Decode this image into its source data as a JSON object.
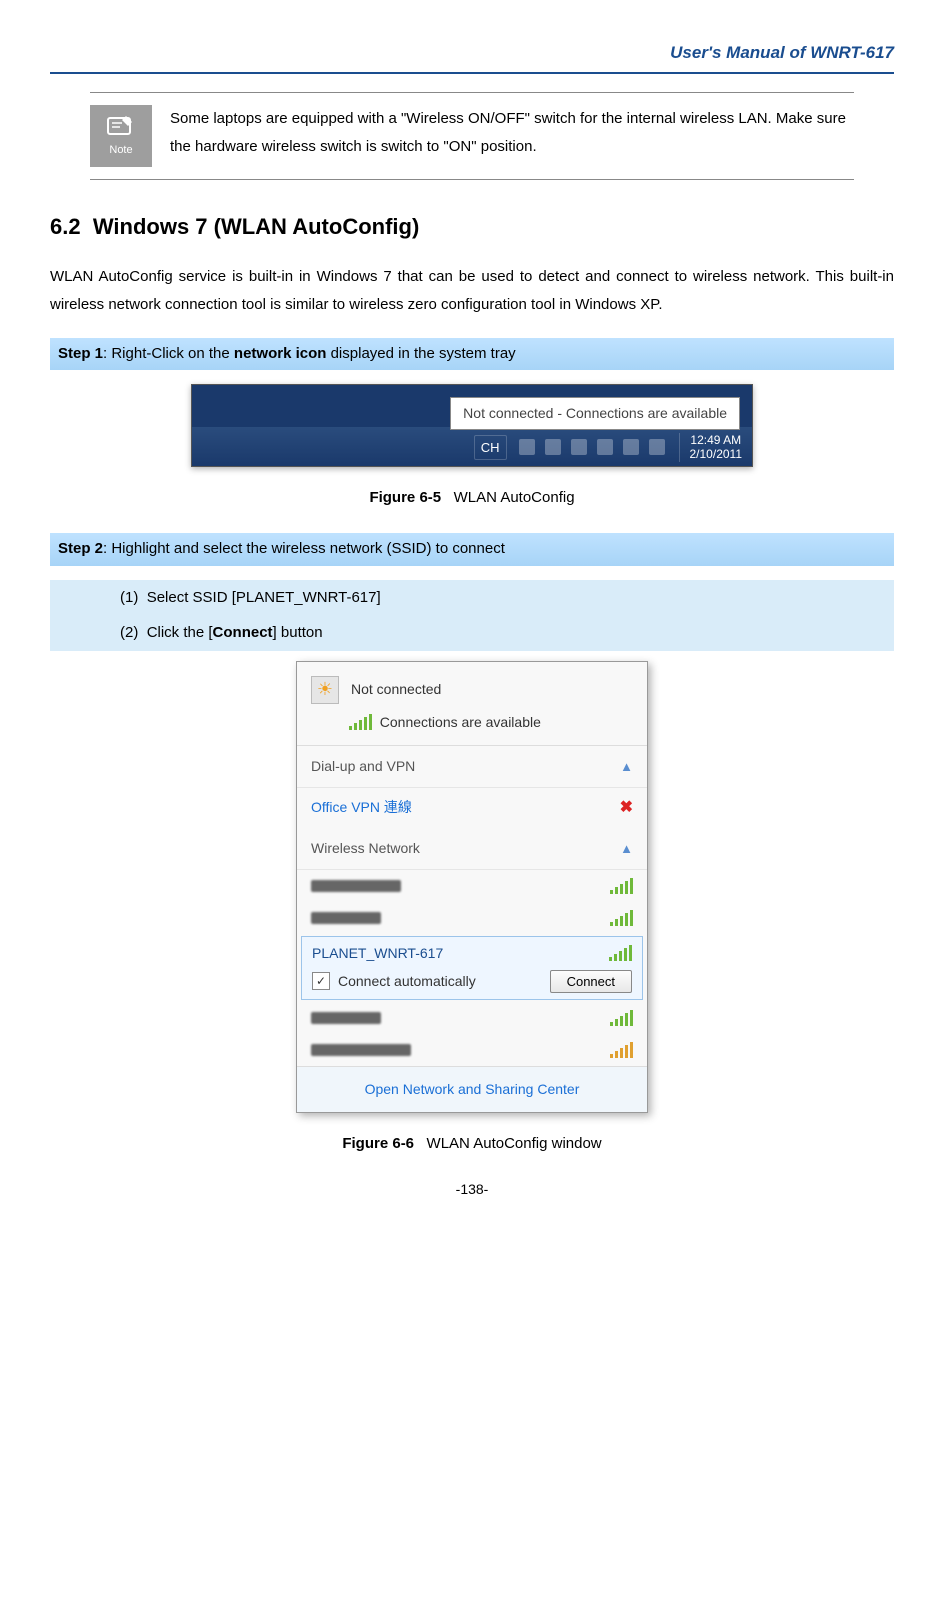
{
  "header": {
    "title": "User's Manual of WNRT-617"
  },
  "note": {
    "label": "Note",
    "text": "Some laptops are equipped with a \"Wireless ON/OFF\" switch for the internal wireless LAN. Make sure the hardware wireless switch is switch to \"ON\" position."
  },
  "section": {
    "number": "6.2",
    "title": "Windows 7 (WLAN AutoConfig)",
    "intro": "WLAN AutoConfig service is built-in in Windows 7 that can be used to detect and connect to wireless network. This built-in wireless network connection tool is similar to wireless zero configuration tool in Windows XP."
  },
  "step1": {
    "label": "Step 1",
    "text_prefix": ": Right-Click on the ",
    "bold": "network icon",
    "text_suffix": " displayed in the system tray"
  },
  "tray": {
    "tooltip": "Not connected - Connections are available",
    "ch": "CH",
    "time": "12:49 AM",
    "date": "2/10/2011"
  },
  "fig1": {
    "label": "Figure 6-5",
    "caption": "WLAN AutoConfig"
  },
  "step2": {
    "label": "Step 2",
    "text": ": Highlight and select the wireless network (SSID) to connect",
    "sub1_num": "(1)",
    "sub1_text": "Select SSID [PLANET_WNRT-617]",
    "sub2_num": "(2)",
    "sub2_prefix": "Click the [",
    "sub2_bold": "Connect",
    "sub2_suffix": "] button"
  },
  "netwin": {
    "not_connected": "Not connected",
    "available": "Connections are available",
    "dialup": "Dial-up and VPN",
    "vpn": "Office VPN 連線",
    "wireless": "Wireless Network",
    "selected_ssid": "PLANET_WNRT-617",
    "auto_label": "Connect automatically",
    "connect_btn": "Connect",
    "footer": "Open Network and Sharing Center"
  },
  "fig2": {
    "label": "Figure 6-6",
    "caption": "WLAN AutoConfig window"
  },
  "page_number": "-138-"
}
